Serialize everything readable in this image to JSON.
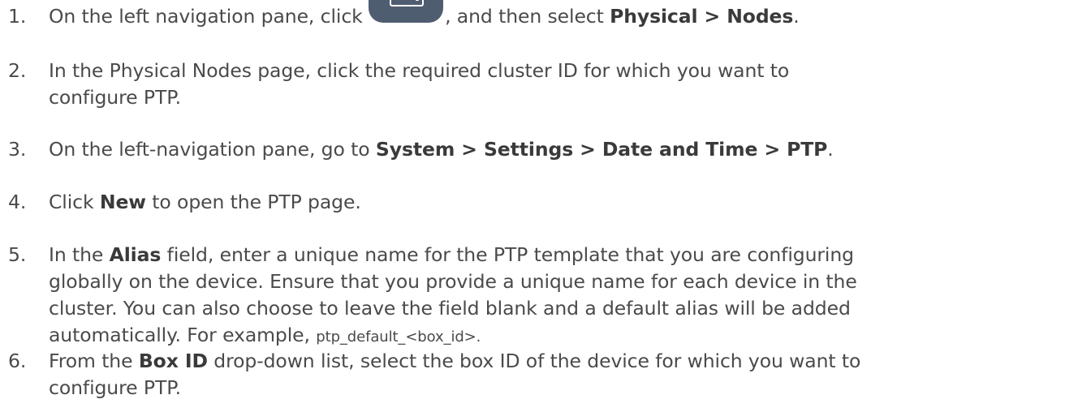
{
  "steps": [
    {
      "number": "1.",
      "prefix": "On the left navigation pane, click ",
      "icon": "node-inventory-icon",
      "middle": ", and then select ",
      "bold": "Physical > Nodes",
      "suffix": "."
    },
    {
      "number": "2.",
      "line1": "In the Physical Nodes page, click the required cluster ID for which you want to",
      "line2": "configure PTP."
    },
    {
      "number": "3.",
      "prefix": "On the left-navigation pane, go to ",
      "bold": "System > Settings > Date and Time > PTP",
      "suffix": "."
    },
    {
      "number": "4.",
      "prefix": "Click ",
      "bold": "New",
      "suffix": " to open the PTP page."
    },
    {
      "number": "5.",
      "prefix": "In the ",
      "bold": "Alias",
      "line1_suffix": " field, enter a unique name for the PTP template that you are configuring",
      "line2": "globally on the device. Ensure that you provide a unique name for each device in the",
      "line3": "cluster. You can also choose to leave the field blank and a default alias will be added",
      "line4_prefix": "automatically. For example, ",
      "line4_code": "ptp_default_<box_id>",
      "line4_suffix": "."
    },
    {
      "number": "6.",
      "prefix": "From the ",
      "bold": "Box ID",
      "line1_suffix": " drop-down list, select the box ID of the device for which you want to",
      "line2": "configure PTP."
    }
  ]
}
